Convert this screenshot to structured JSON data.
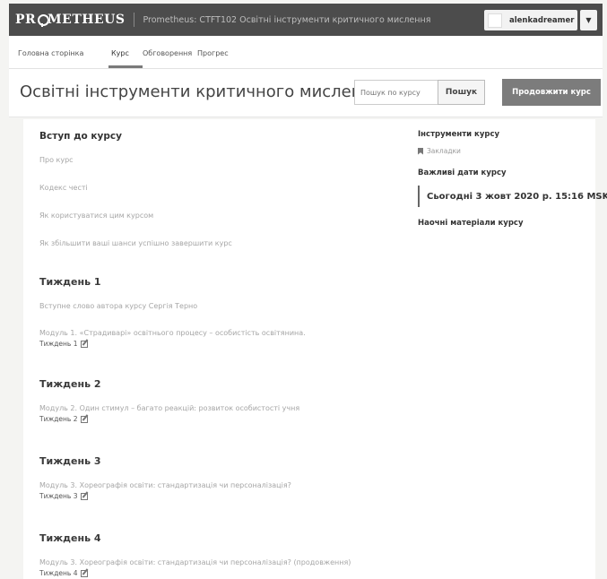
{
  "header": {
    "logo": "PRMETHEUS",
    "course_title": "Prometheus: CTFT102 Освітні інструменти критичного мислення",
    "username": "alenkadreamer"
  },
  "tabs": [
    {
      "label": "Головна сторінка"
    },
    {
      "label": "Курс"
    },
    {
      "label": "Обговорення"
    },
    {
      "label": "Прогрес"
    }
  ],
  "page": {
    "title": "Освітні інструменти критичного мислення",
    "search_placeholder": "Пошук по курсу",
    "search_label": "Пошук",
    "continue_label": "Продовжити курс"
  },
  "intro": {
    "title": "Вступ до курсу",
    "links": [
      "Про курс",
      "Кодекс честі",
      "Як користуватися цим курсом",
      "Як збільшити ваші шанси успішно завершити курс"
    ]
  },
  "weeks": [
    {
      "title": "Тиждень 1",
      "links": [
        "Вступне слово автора курсу Сергія Терно",
        "Модуль 1. «Страдиварі» освітнього процесу – особистість освітянина."
      ],
      "sub": "Тиждень 1"
    },
    {
      "title": "Тиждень 2",
      "links": [
        "Модуль 2. Один стимул – багато реакцій: розвиток особистості учня"
      ],
      "sub": "Тиждень 2"
    },
    {
      "title": "Тиждень 3",
      "links": [
        "Модуль 3. Хореографія освіти: стандартизація чи персоналізація?"
      ],
      "sub": "Тиждень 3"
    },
    {
      "title": "Тиждень 4",
      "links": [
        "Модуль 3. Хореографія освіти: стандартизація чи персоналізація? (продовження)"
      ],
      "sub": "Тиждень 4"
    }
  ],
  "sidebar": {
    "tools_title": "Інструменти курсу",
    "bookmarks_label": "Закладки",
    "dates_title": "Важливі дати курсу",
    "today": "Сьогодні 3 жовт 2020 р. 15:16 MSK",
    "materials_title": "Наочні матеріали курсу"
  },
  "colors": {
    "topbar": "#4c4c4c",
    "continue_button": "#7c7c7c"
  },
  "icons": [
    "pencil-edit-icon",
    "bookmark-icon",
    "dropdown-caret-icon"
  ]
}
